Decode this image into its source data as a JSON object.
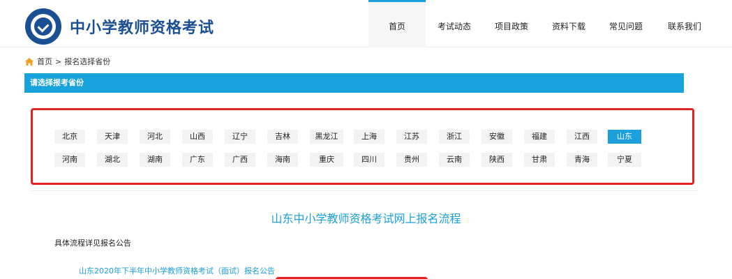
{
  "header": {
    "site_title": "中小学教师资格考试",
    "nav": [
      "首页",
      "考试动态",
      "项目政策",
      "资料下载",
      "常见问题",
      "联系我们"
    ]
  },
  "breadcrumb": {
    "home": "首页",
    "separator": ">",
    "current": "报名选择省份"
  },
  "section_bar": {
    "title": "请选择报考省份"
  },
  "provinces": {
    "row1": [
      "北京",
      "天津",
      "河北",
      "山西",
      "辽宁",
      "吉林",
      "黑龙江",
      "上海",
      "江苏",
      "浙江",
      "安徽",
      "福建",
      "江西",
      "山东"
    ],
    "row2": [
      "河南",
      "湖北",
      "湖南",
      "广东",
      "广西",
      "海南",
      "重庆",
      "四川",
      "贵州",
      "云南",
      "陕西",
      "甘肃",
      "青海",
      "宁夏"
    ],
    "selected": "山东"
  },
  "process": {
    "title": "山东中小学教师资格考试网上报名流程",
    "note": "具体流程详见报名公告",
    "notice_link": "山东2020年下半年中小学教师资格考试（面试）报名公告"
  },
  "colors": {
    "accent": "#1ba0db",
    "brand": "#1a4f93",
    "highlight": "#e02424"
  }
}
